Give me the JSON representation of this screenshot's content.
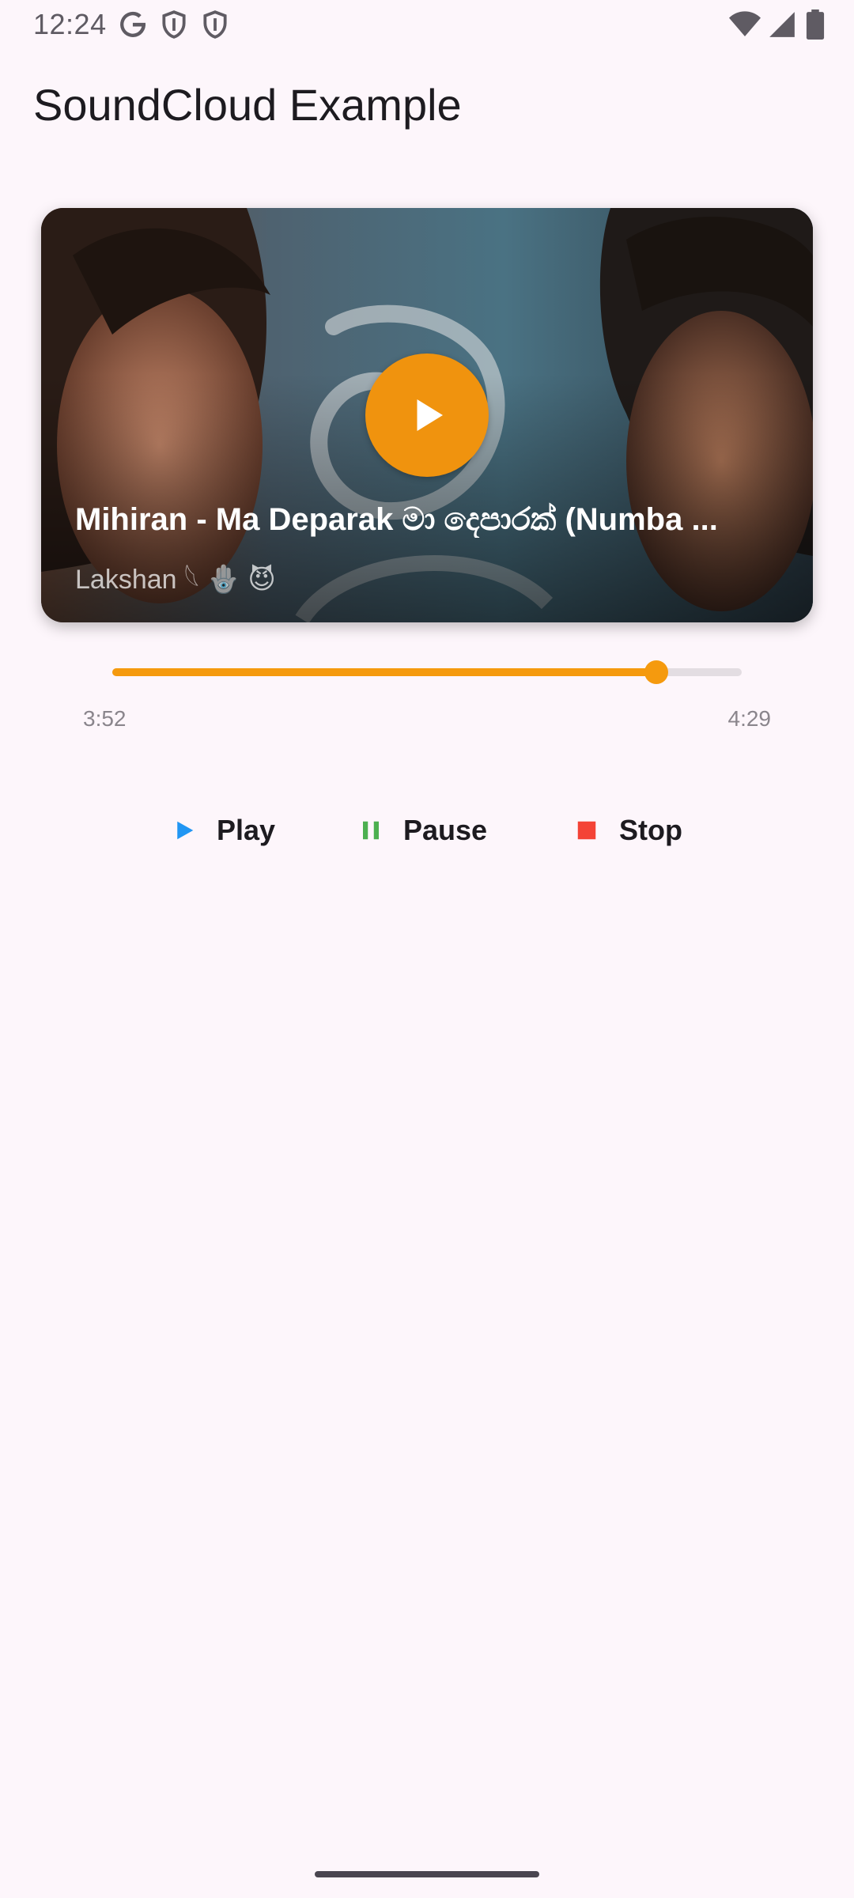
{
  "status_bar": {
    "time": "12:24",
    "left_icons": [
      "google-icon",
      "shield-icon",
      "shield-icon"
    ],
    "right_icons": [
      "wifi-icon",
      "signal-icon",
      "battery-icon"
    ]
  },
  "app_bar": {
    "title": "SoundCloud Example"
  },
  "track": {
    "title": "Mihiran - Ma Deparak මා දෙපාරක් (Numba ...",
    "artist": "Lakshan 𓆩 🪬 😈",
    "accent_color": "#f0930e"
  },
  "progress": {
    "current_time": "3:52",
    "total_time": "4:29",
    "fraction": 0.864,
    "color": "#f59a0e"
  },
  "controls": {
    "play_label": "Play",
    "pause_label": "Pause",
    "stop_label": "Stop",
    "play_color": "#2196f3",
    "pause_color": "#4caf50",
    "stop_color": "#f44336"
  }
}
